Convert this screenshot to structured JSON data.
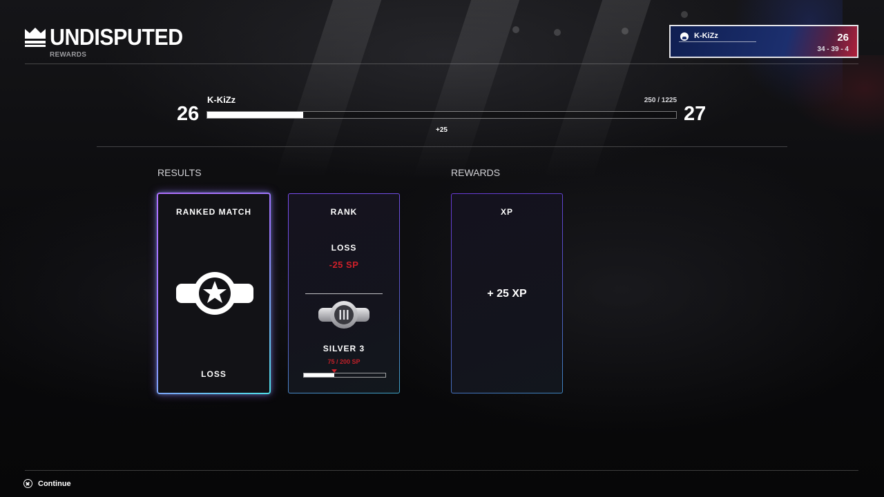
{
  "header": {
    "logo_text": "UNDISPUTED",
    "subtitle": "REWARDS"
  },
  "player_card": {
    "name": "K-KiZz",
    "level": "26",
    "record": "34 - 39 - 4",
    "platform_icon": "playstation-icon",
    "accent_colors": [
      "#1c2f6e",
      "#b0203a"
    ]
  },
  "level_progress": {
    "player_name": "K-KiZz",
    "current_level": "26",
    "next_level": "27",
    "progress_text": "250 / 1225",
    "progress_fraction": 0.204,
    "gain_text": "+25"
  },
  "sections": {
    "results_label": "RESULTS",
    "rewards_label": "REWARDS"
  },
  "cards": {
    "ranked_match": {
      "title": "RANKED MATCH",
      "icon": "championship-belt-icon",
      "result": "LOSS"
    },
    "rank": {
      "title": "RANK",
      "result": "LOSS",
      "delta": "-25 SP",
      "tier_icon": "silver-belt-badge-icon",
      "tier": "SILVER 3",
      "sp_text": "75  / 200 SP",
      "sp_fraction": 0.375,
      "delta_color": "#d0202a"
    },
    "xp": {
      "title": "XP",
      "value": "+ 25 XP"
    }
  },
  "footer": {
    "continue_icon": "cross-button-icon",
    "continue_label": "Continue"
  }
}
